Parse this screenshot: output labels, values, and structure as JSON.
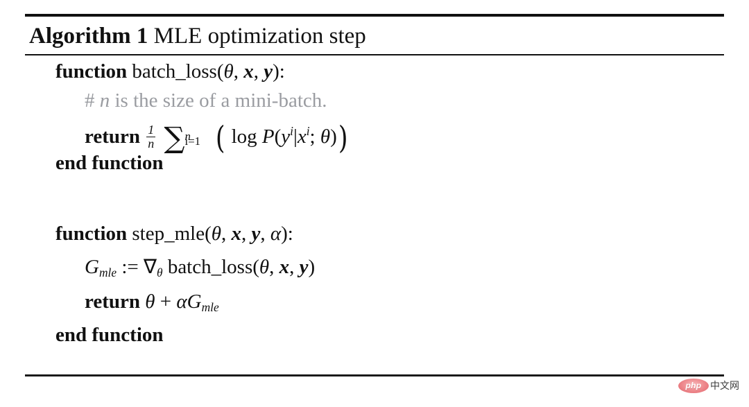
{
  "document": {
    "type": "algorithm-pseudocode-block",
    "title": {
      "keyword": "Algorithm",
      "number": "1",
      "name": "MLE optimization step"
    },
    "lines": [
      {
        "id": "fn1-signature",
        "indent": 0,
        "keyword": "function",
        "text": "batch_loss(θ, x, y):"
      },
      {
        "id": "fn1-comment",
        "indent": 1,
        "text": "# n is the size of a mini-batch."
      },
      {
        "id": "fn1-return",
        "indent": 1,
        "keyword": "return",
        "text": "1/n Σ_{i=1}^{n} ( log P(y^i | x^i ; θ) )"
      },
      {
        "id": "fn1-end",
        "indent": 0,
        "keyword": "end function",
        "text": ""
      },
      {
        "id": "fn2-signature",
        "indent": 0,
        "keyword": "function",
        "text": "step_mle(θ, x, y, α):"
      },
      {
        "id": "fn2-assign",
        "indent": 1,
        "text": "G_mle := ∇_θ batch_loss(θ, x, y)"
      },
      {
        "id": "fn2-return",
        "indent": 1,
        "keyword": "return",
        "text": "θ + αG_mle"
      },
      {
        "id": "fn2-end",
        "indent": 0,
        "keyword": "end function",
        "text": ""
      }
    ],
    "tokens": {
      "kw_function": "function",
      "kw_return": "return",
      "kw_end_function": "end function",
      "fn1_name": "batch_loss",
      "fn2_name": "step_mle",
      "open_paren": "(",
      "close_paren": ")",
      "comma": ",",
      "colon": ":",
      "semicolon": ";",
      "pipe": "|",
      "plus": "+",
      "assign": ":=",
      "log": "log",
      "prob": "P",
      "theta": "θ",
      "alpha": "α",
      "x": "x",
      "y": "y",
      "n": "n",
      "i": "i",
      "one": "1",
      "i_eq_1": "i=1",
      "sigma": "∑",
      "nabla": "∇",
      "G": "G",
      "mle_sub": "mle",
      "hash": "#",
      "comment_body": "is the size of a mini-batch."
    }
  },
  "watermark": {
    "logo_text": "php",
    "site_text": "中文网"
  },
  "colors": {
    "text": "#111111",
    "comment": "#9a9ca1",
    "rule": "#111111",
    "watermark_badge": "#e8767c",
    "watermark_text": "#3b3b3b",
    "background": "#ffffff"
  }
}
